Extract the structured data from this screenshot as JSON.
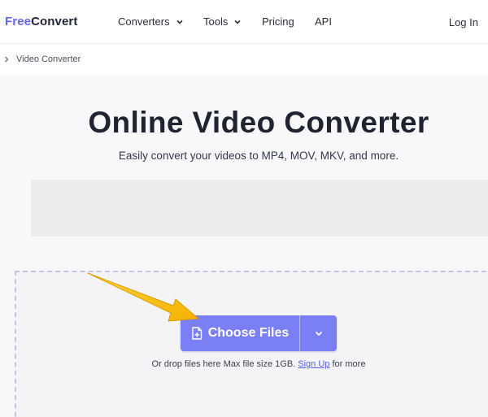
{
  "header": {
    "logo_part1": "Free",
    "logo_part2": "Convert",
    "nav": [
      {
        "label": "Converters",
        "has_dropdown": true
      },
      {
        "label": "Tools",
        "has_dropdown": true
      },
      {
        "label": "Pricing",
        "has_dropdown": false
      },
      {
        "label": "API",
        "has_dropdown": false
      }
    ],
    "login_label": "Log In"
  },
  "breadcrumb": {
    "separator_icon": "chevron-right-icon",
    "current": "Video Converter"
  },
  "hero": {
    "title": "Online Video Converter",
    "subtitle": "Easily convert your videos to MP4, MOV, MKV, and more."
  },
  "upload": {
    "button_label": "Choose Files",
    "button_icon": "file-add-icon",
    "caret_icon": "chevron-down-icon",
    "note_prefix": "Or drop files here Max file size 1GB.",
    "note_link": "Sign Up",
    "note_suffix": "for more"
  },
  "annotation": {
    "arrow_icon": "pointer-arrow-icon",
    "arrow_color": "#f5b800"
  },
  "colors": {
    "brand": "#6366f1",
    "button": "#7b7ff5",
    "link": "#5b60e6"
  }
}
